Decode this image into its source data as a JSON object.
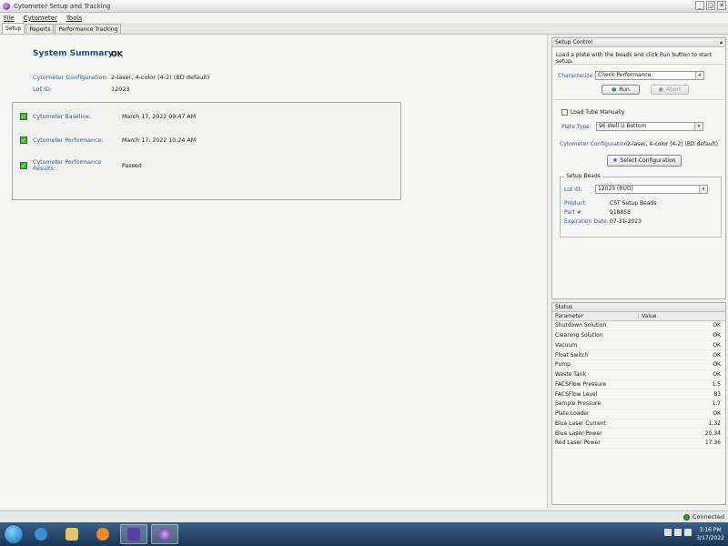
{
  "window": {
    "title": "Cytometer Setup and Tracking",
    "buttons": [
      "_",
      "◲",
      "✕"
    ]
  },
  "menu": [
    "File",
    "Cytometer",
    "Tools"
  ],
  "tabs": [
    "Setup",
    "Reports",
    "Performance Tracking"
  ],
  "summary": {
    "title": "System Summary:",
    "status": "OK",
    "config_label": "Cytometer Configuration:",
    "config_value": "2-laser, 4-color (4-2) (BD default)",
    "lot_label": "Lot ID:",
    "lot_value": "12023"
  },
  "results": [
    {
      "label": "Cytometer Baseline:",
      "value": "March 17, 2022 09:47 AM"
    },
    {
      "label": "Cytometer Performance:",
      "value": "March 17, 2022 10:24 AM"
    },
    {
      "label": "Cytometer Performance Results:",
      "value": "Passed"
    }
  ],
  "setup_control": {
    "title": "Setup Control",
    "instruction": "Load a plate with the beads and click Run button to start setup.",
    "characterize_label": "Characterize:",
    "characterize_value": "Check Performance",
    "run_label": "Run",
    "abort_label": "Abort",
    "load_tube_label": "Load Tube Manually",
    "plate_type_label": "Plate Type:",
    "plate_type_value": "96 Well U Bottom",
    "config_label": "Cytometer Configuration:",
    "config_value": "2-laser, 4-color (4-2) (BD default)",
    "select_config_label": "Select Configuration",
    "beads_title": "Setup Beads",
    "lot_label": "Lot ID:",
    "lot_value": "12023 (RUO)",
    "product_label": "Product:",
    "product_value": "CST Setup Beads",
    "part_label": "Part #:",
    "part_value": "918858",
    "exp_label": "Expiration Date:",
    "exp_value": "07-31-2023"
  },
  "status_panel": {
    "title": "Status",
    "col_param": "Parameter",
    "col_value": "Value",
    "rows": [
      {
        "p": "Shutdown Solution",
        "v": "OK"
      },
      {
        "p": "Cleaning Solution",
        "v": "OK"
      },
      {
        "p": "Vacuum",
        "v": "OK"
      },
      {
        "p": "Float Switch",
        "v": "OK"
      },
      {
        "p": "Pump",
        "v": "OK"
      },
      {
        "p": "Waste Tank",
        "v": "OK"
      },
      {
        "p": "FACSFlow Pressure",
        "v": "1.5"
      },
      {
        "p": "FACSFlow Level",
        "v": "83"
      },
      {
        "p": "Sample Pressure",
        "v": "1.7"
      },
      {
        "p": "Plate Loader",
        "v": "OK"
      },
      {
        "p": "Blue Laser Current",
        "v": "1.32"
      },
      {
        "p": "Blue Laser Power",
        "v": "20.34"
      },
      {
        "p": "Red Laser Power",
        "v": "17.36"
      }
    ]
  },
  "statusbar": {
    "connection": "Connected"
  },
  "taskbar": {
    "time": "3:16 PM",
    "date": "3/17/2022"
  }
}
